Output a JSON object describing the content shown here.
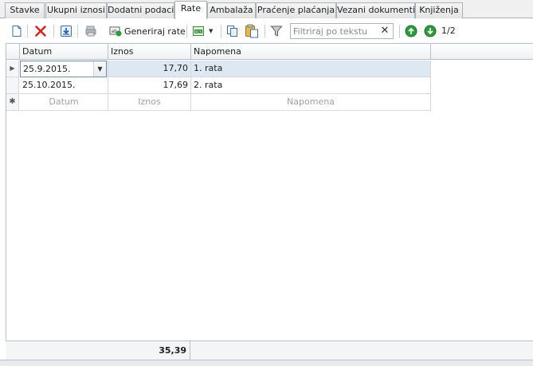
{
  "tabs": [
    {
      "label": "Stavke",
      "active": false
    },
    {
      "label": "Ukupni iznosi",
      "active": false
    },
    {
      "label": "Dodatni podaci",
      "active": false
    },
    {
      "label": "Rate",
      "active": true
    },
    {
      "label": "Ambalaža",
      "active": false
    },
    {
      "label": "Praćenje plaćanja",
      "active": false
    },
    {
      "label": "Vezani dokumenti",
      "active": false
    },
    {
      "label": "Knjiženja",
      "active": false
    }
  ],
  "toolbar": {
    "generate_label": "Generiraj rate",
    "filter_placeholder": "Filtriraj po tekstu",
    "page_indicator": "1/2"
  },
  "grid": {
    "columns": [
      "Datum",
      "Iznos",
      "Napomena"
    ],
    "rows": [
      {
        "datum": "25.9.2015.",
        "iznos": "17,70",
        "napomena": "1. rata"
      },
      {
        "datum": "25.10.2015.",
        "iznos": "17,69",
        "napomena": "2. rata"
      }
    ],
    "new_row": {
      "datum": "Datum",
      "iznos": "Iznos",
      "napomena": "Napomena"
    },
    "footer_sum": "35,39"
  },
  "colors": {
    "accent": "#dde8f3",
    "delete": "#d9231b",
    "nav_green": "#2e9b3a"
  }
}
